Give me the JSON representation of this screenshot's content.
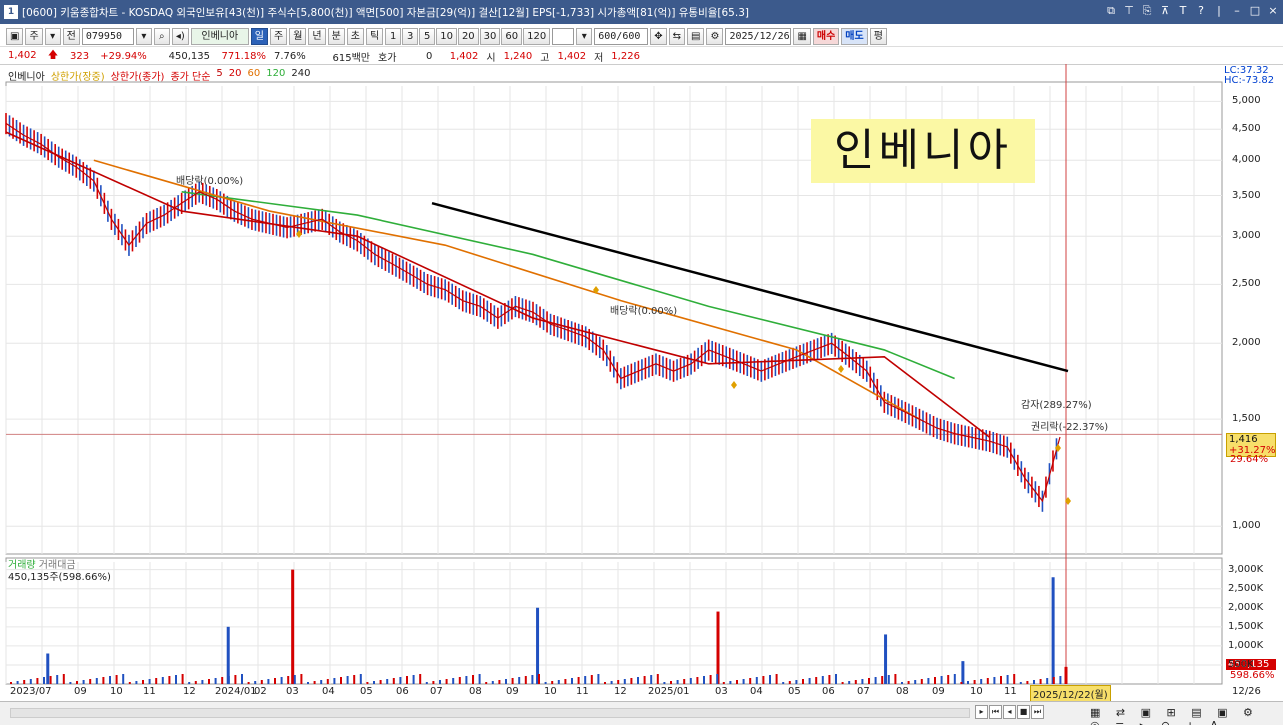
{
  "titlebar": {
    "icon": "1",
    "text": "[0600] 키움종합차트 - KOSDAQ 외국인보유[43(천)] 주식수[5,800(천)] 액면[500] 자본금[29(억)] 결산[12월] EPS[-1,733] 시가총액[81(억)] 유통비율[65.3]"
  },
  "toolbar": {
    "period": "주",
    "prev": "전",
    "code": "079950",
    "stock_name": "인베니아",
    "day_btn": "일",
    "week_btn": "주",
    "month_btn": "월",
    "year_btn": "년",
    "min_btn": "분",
    "sec_btn": "초",
    "tick_btn": "틱",
    "intervals": [
      "1",
      "3",
      "5",
      "10",
      "20",
      "30",
      "60",
      "120"
    ],
    "count": "600",
    "count_total": "/600",
    "date": "2025/12/26",
    "buy": "매수",
    "sell": "매도",
    "avg": "평"
  },
  "pricebar": {
    "price": "1,402",
    "change": "323",
    "change_pct": "+29.94%",
    "volume": "450,135",
    "vol_pct": "771.18%",
    "turnover": "7.76%",
    "amount": "615백만",
    "quote_label": "호가",
    "quote": "0",
    "close": "1,402",
    "open_label": "시",
    "open": "1,240",
    "high_label": "고",
    "high": "1,402",
    "low_label": "저",
    "low": "1,226"
  },
  "legend": {
    "name": "인베니아",
    "upper_limit_intraday": "상한가(장중)",
    "upper_limit_close": "상한가(종가)",
    "ma_label": "종가 단순",
    "ma": [
      "5",
      "20",
      "60",
      "120",
      "240"
    ]
  },
  "overlay_title": "인베니아",
  "annotations": {
    "dividend1": "배당락(0.00%)",
    "dividend2": "배당락(0.00%)",
    "capital_increase": "감자(289.27%)",
    "rights": "권리락(-22.37%)"
  },
  "right_axis": {
    "lc": "LC:37.32",
    "hc": "HC:-73.82",
    "price_tag": "1,416",
    "price_tag_pct": "+31.27%",
    "sub_tag": "29.64%",
    "price_ticks": [
      "5,000",
      "4,500",
      "4,000",
      "3,500",
      "3,000",
      "2,500",
      "2,000",
      "1,500",
      "1,000"
    ],
    "volume_ticks": [
      "3,000K",
      "2,500K",
      "2,000K",
      "1,500K",
      "1,000K",
      "500K"
    ],
    "vol_tag": "450,135",
    "vol_tag_pct": "598.66%",
    "date_tag": "12/26"
  },
  "volume_legend": {
    "vol": "거래량",
    "amount": "거래대금",
    "value": "450,135주(598.66%)"
  },
  "x_axis": {
    "labels": [
      "2023/07",
      "09",
      "10",
      "11",
      "12",
      "2024/01",
      "02",
      "03",
      "04",
      "05",
      "06",
      "07",
      "08",
      "09",
      "10",
      "11",
      "12",
      "2025/01",
      "03",
      "04",
      "05",
      "06",
      "07",
      "08",
      "09",
      "10",
      "11"
    ],
    "highlight": "2025/12/22(월)"
  },
  "chart_data": {
    "type": "line",
    "title": "인베니아",
    "price_ylim": [
      900,
      5300
    ],
    "volume_ylim": [
      0,
      3200
    ],
    "log_scale": true,
    "grid": true,
    "series": [
      {
        "name": "인베니아",
        "x": [
          0,
          10,
          20,
          30,
          40,
          50,
          60,
          70,
          80,
          90,
          100,
          110,
          120,
          130,
          140,
          150,
          160,
          170,
          180,
          190,
          200,
          210,
          220,
          230,
          240,
          250,
          260,
          270,
          280,
          290,
          300,
          310,
          320,
          330,
          340,
          350,
          360,
          370,
          380,
          390,
          400,
          410,
          420,
          430,
          440,
          450,
          460,
          470,
          480,
          490,
          500,
          510,
          520,
          530,
          540,
          550,
          560,
          570,
          580,
          590,
          600
        ],
        "values": [
          4600,
          4400,
          4250,
          4050,
          3900,
          3700,
          3200,
          2900,
          3150,
          3250,
          3400,
          3550,
          3450,
          3300,
          3200,
          3150,
          3100,
          3150,
          3200,
          3050,
          2950,
          2800,
          2700,
          2600,
          2500,
          2450,
          2350,
          2300,
          2200,
          2300,
          2250,
          2150,
          2100,
          2050,
          1950,
          1750,
          1800,
          1850,
          1800,
          1850,
          1950,
          1900,
          1850,
          1800,
          1850,
          1900,
          1950,
          2000,
          1900,
          1800,
          1600,
          1550,
          1500,
          1450,
          1420,
          1400,
          1380,
          1350,
          1200,
          1100,
          1402
        ],
        "color": "#2050c0"
      },
      {
        "name": "120",
        "x": [
          100,
          200,
          300,
          400,
          500,
          540
        ],
        "values": [
          3550,
          3250,
          2800,
          2300,
          1950,
          1750
        ],
        "color": "#2fae3a"
      },
      {
        "name": "60",
        "x": [
          50,
          150,
          250,
          350,
          450,
          520
        ],
        "values": [
          4000,
          3300,
          2900,
          2350,
          1950,
          1500
        ],
        "color": "#e07000"
      },
      {
        "name": "20",
        "x": [
          0,
          100,
          200,
          300,
          400,
          500,
          560
        ],
        "values": [
          4450,
          3300,
          3000,
          2200,
          1850,
          1900,
          1400
        ],
        "color": "#c00000"
      }
    ],
    "volume": [
      0,
      0,
      800,
      0,
      0,
      0,
      0,
      0,
      0,
      0,
      0,
      0,
      0,
      0,
      0,
      0,
      1500,
      0,
      0,
      0,
      0,
      3000,
      0,
      0,
      0,
      0,
      0,
      0,
      0,
      0,
      0,
      0,
      0,
      0,
      0,
      0,
      0,
      0,
      0,
      0,
      2000,
      0,
      0,
      0,
      0,
      0,
      0,
      0,
      0,
      0,
      0,
      0,
      0,
      0,
      1900,
      0,
      0,
      0,
      0,
      0,
      0,
      0,
      0,
      0,
      0,
      0,
      0,
      1300,
      0,
      0,
      0,
      0,
      0,
      600,
      0,
      0,
      0,
      0,
      0,
      0,
      2800,
      450
    ],
    "trendline": {
      "start": "2024/07",
      "end": "2025/12",
      "values": [
        3400,
        1800
      ],
      "color": "#000000"
    }
  }
}
